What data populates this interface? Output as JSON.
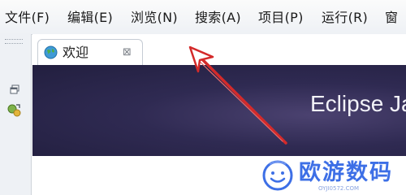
{
  "menubar": {
    "items": [
      {
        "label": "文件(F)"
      },
      {
        "label": "编辑(E)"
      },
      {
        "label": "浏览(N)"
      },
      {
        "label": "搜索(A)"
      },
      {
        "label": "项目(P)"
      },
      {
        "label": "运行(R)"
      },
      {
        "label": "窗"
      }
    ]
  },
  "side_toolbar": {
    "icons": [
      "restore-icon",
      "perspective-icon"
    ]
  },
  "editor": {
    "tab": {
      "label": "欢迎",
      "icon": "globe-icon",
      "close_symbol": "⊠"
    },
    "banner": {
      "title": "Eclipse Ja"
    }
  },
  "annotation": {
    "color": "#d42a2a",
    "icon": "arrow-icon"
  },
  "watermark": {
    "brand": "欧游数码",
    "url": "OYJI0572.COM",
    "color": "#3d6fe6"
  }
}
